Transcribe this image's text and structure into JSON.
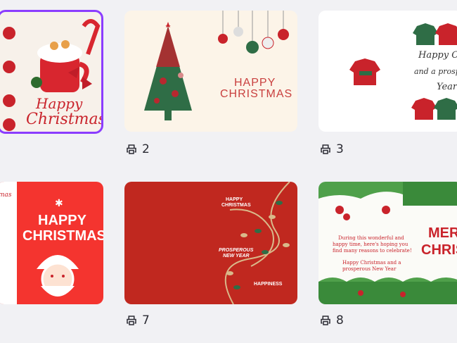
{
  "pages": [
    {
      "card": {
        "line1": "Happy",
        "line2": "Christmas"
      }
    },
    {
      "number": "2",
      "card": {
        "line1": "HAPPY",
        "line2": "CHRISTMAS"
      }
    },
    {
      "number": "3",
      "card": {
        "line1": "Happy Chris",
        "line2": "and a prosperou",
        "line3": "Year"
      }
    },
    {
      "card": {
        "side": "mas",
        "line1": "HAPPY",
        "line2": "CHRISTMAS"
      }
    },
    {
      "number": "7",
      "card": {
        "line1": "HAPPY",
        "line2": "CHRISTMAS",
        "line3": "PROSPEROUS",
        "line4": "NEW YEAR",
        "line5": "HAPPINESS"
      }
    },
    {
      "number": "8",
      "card": {
        "msg1": "During this wonderful and",
        "msg2": "happy time, here's hoping you",
        "msg3": "find many reasons to celebrate!",
        "msg4": "Happy Christmas and a",
        "msg5": "prosperous New Year",
        "big1": "MERR",
        "big2": "CHRISTM"
      }
    }
  ],
  "colors": {
    "selection": "#8b3dff",
    "red": "#d8262f"
  }
}
